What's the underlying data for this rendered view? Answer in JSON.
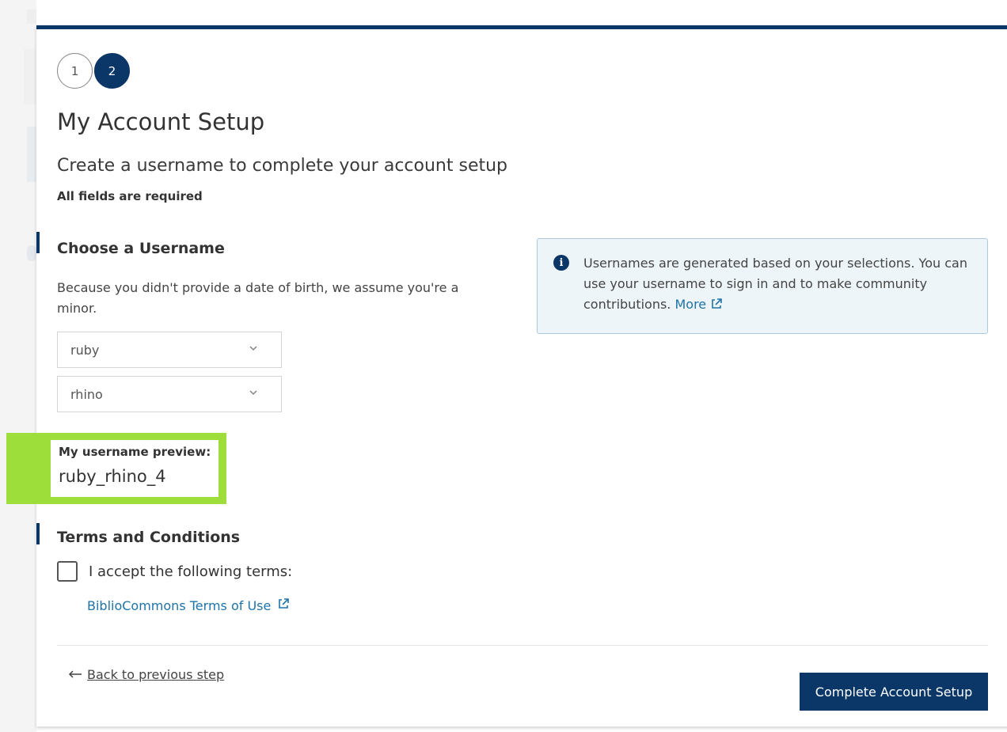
{
  "stepper": {
    "steps": [
      "1",
      "2"
    ],
    "current_step": 2
  },
  "title": "My Account Setup",
  "subtitle": "Create a username to complete your account setup",
  "required_note": "All fields are required",
  "username_section": {
    "heading": "Choose a Username",
    "description": "Because you didn't provide a date of birth, we assume you're a minor.",
    "selects": [
      {
        "value": "ruby"
      },
      {
        "value": "rhino"
      }
    ],
    "preview_label": "My username preview:",
    "preview_value": "ruby_rhino_4"
  },
  "info_box": {
    "text": "Usernames are generated based on your selections. You can use your username to sign in and to make community contributions.",
    "more_link": "More",
    "icon": "info-icon"
  },
  "terms_section": {
    "heading": "Terms and Conditions",
    "checkbox_label": "I accept the following terms:",
    "checked": false,
    "link_label": "BiblioCommons Terms of Use"
  },
  "footer": {
    "back_label": "Back to previous step",
    "submit_label": "Complete Account Setup"
  },
  "colors": {
    "brand": "#0b3768",
    "link": "#1e73a8",
    "highlight": "#9dde3b",
    "info_bg": "#eef5f9"
  }
}
